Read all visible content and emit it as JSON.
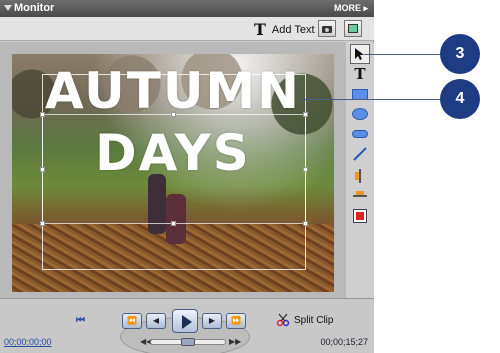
{
  "window": {
    "title": "Monitor",
    "more_label": "MORE"
  },
  "toolbar": {
    "add_text_label": "Add Text",
    "add_text_icon": "T"
  },
  "video": {
    "title_line1": "AUTUMN",
    "title_line2": "DAYS"
  },
  "tools": {
    "icons": [
      "selection-arrow-icon",
      "horizontal-type-icon",
      "rectangle-icon",
      "ellipse-icon",
      "rounded-rectangle-icon",
      "line-icon",
      "text-alignment-icon",
      "center-icon",
      "color-swatch-icon"
    ]
  },
  "controls": {
    "timecode_current": "00;00;00;00",
    "timecode_duration": "00;00;15;27",
    "goto_first_label": "⏮",
    "step_back_label": "⏪",
    "prev_frame_label": "◀",
    "next_frame_label": "▶",
    "step_forward_label": "⏩",
    "split_clip_label": "Split Clip"
  },
  "callouts": {
    "c3": "3",
    "c4": "4"
  },
  "colors": {
    "callout": "#1e3c84",
    "accent": "#2a4da0"
  }
}
